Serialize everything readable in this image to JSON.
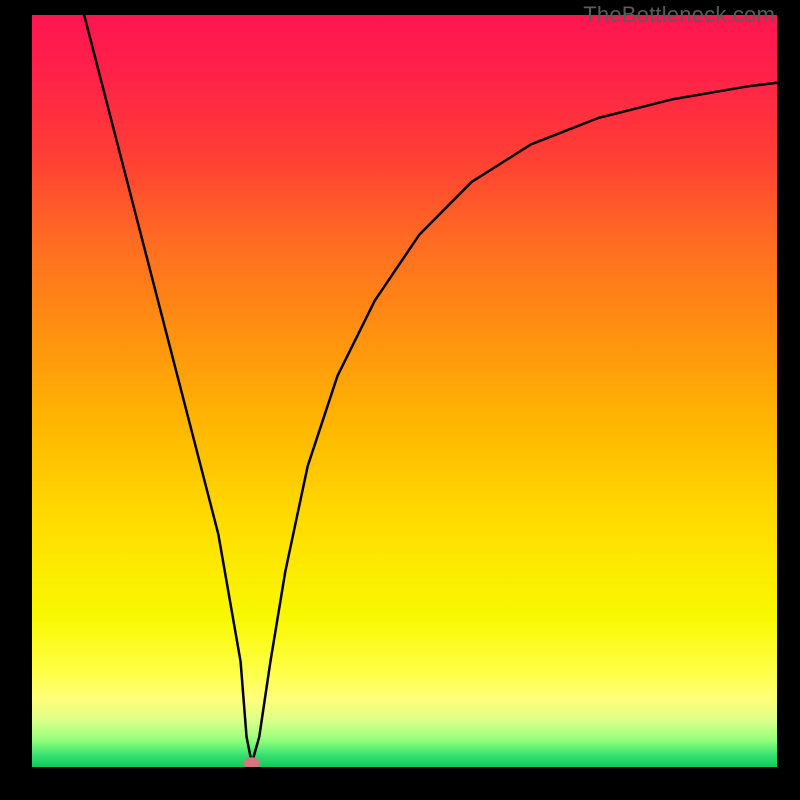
{
  "watermark": "TheBottleneck.com",
  "chart_data": {
    "type": "line",
    "title": "",
    "xlabel": "",
    "ylabel": "",
    "xlim": [
      0,
      100
    ],
    "ylim": [
      0,
      100
    ],
    "series": [
      {
        "name": "curve",
        "x": [
          7,
          10,
          13,
          16,
          19,
          22,
          25,
          28,
          28.8,
          29.5,
          30.5,
          32,
          34,
          37,
          41,
          46,
          52,
          59,
          67,
          76,
          86,
          96,
          100
        ],
        "y": [
          100,
          88.5,
          77,
          65.5,
          54,
          42.5,
          31,
          14,
          4,
          0.5,
          4,
          14,
          26,
          40,
          52,
          62,
          70.8,
          77.8,
          82.8,
          86.3,
          88.8,
          90.5,
          91
        ]
      }
    ],
    "marker": {
      "x": 29.5,
      "y": 0.5
    },
    "gradient_stops": [
      {
        "offset": 0.0,
        "color": "#ff1550"
      },
      {
        "offset": 0.08,
        "color": "#ff2248"
      },
      {
        "offset": 0.18,
        "color": "#ff3c36"
      },
      {
        "offset": 0.3,
        "color": "#ff6b22"
      },
      {
        "offset": 0.42,
        "color": "#ff9010"
      },
      {
        "offset": 0.55,
        "color": "#ffb800"
      },
      {
        "offset": 0.68,
        "color": "#ffde00"
      },
      {
        "offset": 0.8,
        "color": "#f8f800"
      },
      {
        "offset": 0.87,
        "color": "#ffff44"
      },
      {
        "offset": 0.91,
        "color": "#ffff7a"
      },
      {
        "offset": 0.94,
        "color": "#d8ff8a"
      },
      {
        "offset": 0.965,
        "color": "#90ff7a"
      },
      {
        "offset": 0.985,
        "color": "#34e070"
      },
      {
        "offset": 1.0,
        "color": "#12c85c"
      }
    ]
  }
}
